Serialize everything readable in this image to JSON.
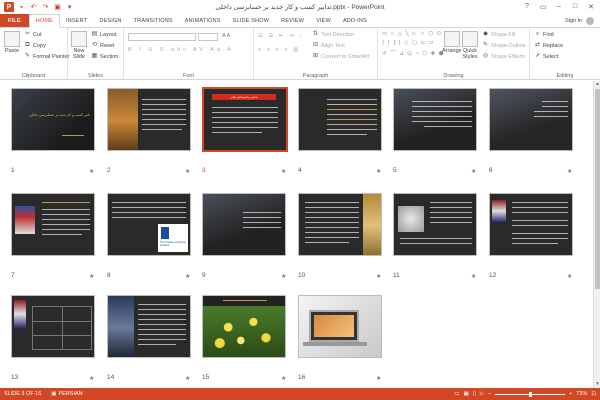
{
  "app": {
    "title": "تدابیر کسب و کار جدید بر حسابرسی داخلی.pptx - PowerPoint",
    "logo": "P",
    "accent": "#d24726"
  },
  "qat": [
    "save-icon",
    "undo-icon",
    "redo-icon",
    "start-from-beginning-icon",
    "customize-icon"
  ],
  "window": {
    "help": "?",
    "restore_ribbon": "▭",
    "minimize": "–",
    "maximize": "□",
    "close": "✕"
  },
  "tabs": [
    {
      "label": "FILE",
      "key": "file"
    },
    {
      "label": "HOME",
      "key": "home"
    },
    {
      "label": "INSERT",
      "key": "insert"
    },
    {
      "label": "DESIGN",
      "key": "design"
    },
    {
      "label": "TRANSITIONS",
      "key": "transitions"
    },
    {
      "label": "ANIMATIONS",
      "key": "animations"
    },
    {
      "label": "SLIDE SHOW",
      "key": "slideshow"
    },
    {
      "label": "REVIEW",
      "key": "review"
    },
    {
      "label": "VIEW",
      "key": "view"
    },
    {
      "label": "ADD-INS",
      "key": "addins"
    }
  ],
  "signin": "Sign in",
  "ribbon": {
    "clipboard": {
      "label": "Clipboard",
      "paste": "Paste",
      "cut": "Cut",
      "copy": "Copy",
      "format_painter": "Format Painter"
    },
    "slides": {
      "label": "Slides",
      "new_slide": "New\nSlide",
      "layout": "Layout",
      "reset": "Reset",
      "section": "Section"
    },
    "font": {
      "label": "Font"
    },
    "paragraph": {
      "label": "Paragraph",
      "text_direction": "Text Direction",
      "align_text": "Align Text",
      "convert_smartart": "Convert to SmartArt"
    },
    "drawing": {
      "label": "Drawing",
      "arrange": "Arrange",
      "quick_styles": "Quick\nStyles",
      "shape_fill": "Shape Fill",
      "shape_outline": "Shape Outline",
      "shape_effects": "Shape Effects"
    },
    "editing": {
      "label": "Editing",
      "find": "Find",
      "replace": "Replace",
      "select": "Select"
    }
  },
  "slides": [
    {
      "num": "1",
      "title": "تاثیر کسب و کار جدید بر حسابرسی داخلی"
    },
    {
      "num": "2",
      "title": ""
    },
    {
      "num": "3",
      "title": "تدابیر و استراتژی های"
    },
    {
      "num": "4",
      "title": ""
    },
    {
      "num": "5",
      "title": ""
    },
    {
      "num": "6",
      "title": ""
    },
    {
      "num": "7",
      "title": ""
    },
    {
      "num": "8",
      "title": "The Institute of Internal Auditors"
    },
    {
      "num": "9",
      "title": ""
    },
    {
      "num": "10",
      "title": ""
    },
    {
      "num": "11",
      "title": ""
    },
    {
      "num": "12",
      "title": ""
    },
    {
      "num": "13",
      "title": ""
    },
    {
      "num": "14",
      "title": ""
    },
    {
      "num": "15",
      "title": ""
    },
    {
      "num": "16",
      "title": ""
    }
  ],
  "star": "★",
  "status": {
    "slide_of": "SLIDE 3 OF 16",
    "language": "PERSIAN",
    "zoom": "73%",
    "zoom_fraction": 0.5
  }
}
